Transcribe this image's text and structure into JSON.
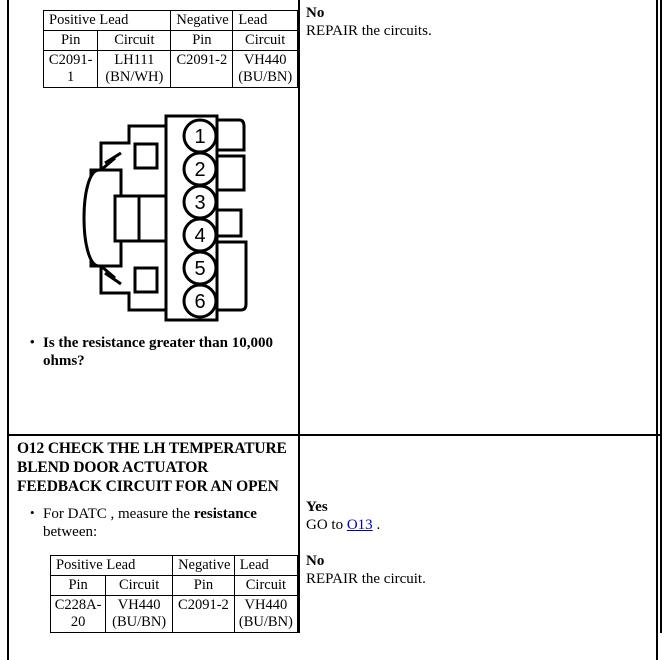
{
  "document": {
    "type": "diagnostic-pinpoint-test"
  },
  "step_continued": {
    "lead_table": {
      "group_headers": [
        "Positive Lead",
        "Negative",
        "Lead"
      ],
      "column_headers": [
        "Pin",
        "Circuit",
        "Pin",
        "Circuit"
      ],
      "rows": [
        {
          "positive_pin": "C2091-1",
          "positive_circuit": "LH111 (BN/WH)",
          "negative_pin": "C2091-2",
          "negative_circuit": "VH440 (BU/BN)"
        }
      ]
    },
    "connector": {
      "pin_labels": [
        "1",
        "2",
        "3",
        "4",
        "5",
        "6"
      ],
      "pin_count": 6
    },
    "question": "Is the resistance greater than 10,000 ohms?",
    "result": {
      "no_label": "No",
      "no_action": "REPAIR the circuits."
    }
  },
  "step_o12": {
    "header": "O12 CHECK THE LH TEMPERATURE BLEND DOOR ACTUATOR FEEDBACK CIRCUIT FOR AN OPEN",
    "instruction": {
      "prefix": "For DATC , measure the ",
      "emphasis": "resistance",
      "suffix": " between:"
    },
    "lead_table": {
      "group_headers": [
        "Positive Lead",
        "Negative",
        "Lead"
      ],
      "column_headers": [
        "Pin",
        "Circuit",
        "Pin",
        "Circuit"
      ],
      "rows": [
        {
          "positive_pin": "C228A-20",
          "positive_circuit": "VH440 (BU/BN)",
          "negative_pin": "C2091-2",
          "negative_circuit": "VH440 (BU/BN)"
        }
      ]
    },
    "result": {
      "yes_label": "Yes",
      "yes_action_prefix": "GO to ",
      "yes_link": "O13",
      "yes_action_suffix": " .",
      "no_label": "No",
      "no_action": "REPAIR the circuit."
    }
  },
  "colors": {
    "link": "#0000c0",
    "border": "#000000",
    "background": "#ffffff"
  }
}
